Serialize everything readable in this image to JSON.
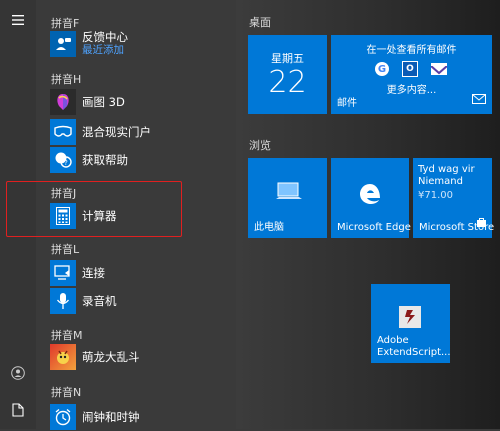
{
  "rail": {
    "menu_icon": "hamburger-icon",
    "user_icon": "user-icon",
    "docs_icon": "documents-icon"
  },
  "groups": [
    {
      "letter": "拼音F",
      "apps": [
        {
          "label": "反馈中心",
          "sub": "最近添加",
          "icon": "feedback-hub-icon"
        }
      ]
    },
    {
      "letter": "拼音H",
      "apps": [
        {
          "label": "画图 3D",
          "icon": "paint-3d-icon"
        },
        {
          "label": "混合现实门户",
          "icon": "mixed-reality-icon"
        },
        {
          "label": "获取帮助",
          "icon": "get-help-icon"
        }
      ]
    },
    {
      "letter": "拼音J",
      "apps": [
        {
          "label": "计算器",
          "icon": "calculator-icon"
        }
      ]
    },
    {
      "letter": "拼音L",
      "apps": [
        {
          "label": "连接",
          "icon": "connect-icon"
        },
        {
          "label": "录音机",
          "icon": "voice-recorder-icon"
        }
      ]
    },
    {
      "letter": "拼音M",
      "apps": [
        {
          "label": "萌龙大乱斗",
          "icon": "dragon-game-icon"
        }
      ]
    },
    {
      "letter": "拼音N",
      "apps": [
        {
          "label": "闹钟和时钟",
          "icon": "alarms-clock-icon"
        }
      ]
    }
  ],
  "sections": {
    "desktop": {
      "title": "桌面",
      "calendar": {
        "day": "星期五",
        "date": "22"
      },
      "mail": {
        "heading": "在一处查看所有邮件",
        "more": "更多内容...",
        "name": "邮件"
      }
    },
    "browse": {
      "title": "浏览",
      "tiles": [
        {
          "name": "此电脑",
          "icon": "this-pc-icon"
        },
        {
          "name": "Microsoft Edge",
          "icon": "edge-icon"
        },
        {
          "name": "Microsoft Store",
          "product": "Tyd wag vir Niemand",
          "price": "¥71.00",
          "icon": "store-icon"
        }
      ]
    },
    "extra": {
      "name": "Adobe ExtendScript...",
      "icon": "adobe-extendscript-icon"
    }
  },
  "colors": {
    "tile_blue": "#0078d7",
    "highlight_red": "#e02020",
    "link_blue": "#4ea3ff"
  }
}
